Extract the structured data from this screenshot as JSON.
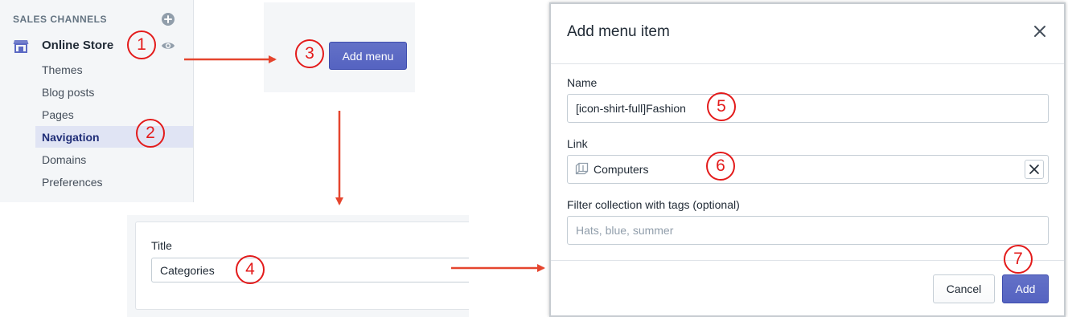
{
  "sidebar": {
    "section_title": "SALES CHANNELS",
    "add_icon": "plus-circle-icon",
    "store": {
      "label": "Online Store",
      "icon": "store-icon",
      "view_icon": "eye-icon"
    },
    "items": [
      {
        "label": "Themes",
        "active": false
      },
      {
        "label": "Blog posts",
        "active": false
      },
      {
        "label": "Pages",
        "active": false
      },
      {
        "label": "Navigation",
        "active": true
      },
      {
        "label": "Domains",
        "active": false
      },
      {
        "label": "Preferences",
        "active": false
      }
    ]
  },
  "add_menu": {
    "button_label": "Add menu"
  },
  "menu_form": {
    "title_label": "Title",
    "title_value": "Categories"
  },
  "modal": {
    "title": "Add menu item",
    "close_icon": "close-icon",
    "name": {
      "label": "Name",
      "value": "[icon-shirt-full]Fashion"
    },
    "link": {
      "label": "Link",
      "value": "Computers",
      "icon": "collection-icon",
      "clear_icon": "close-icon"
    },
    "filter": {
      "label": "Filter collection with tags (optional)",
      "placeholder": "Hats, blue, summer"
    },
    "cancel_label": "Cancel",
    "add_label": "Add"
  },
  "steps": [
    "1",
    "2",
    "3",
    "4",
    "5",
    "6",
    "7"
  ],
  "colors": {
    "accent": "#5c6ac4",
    "annotation": "#e31b1b",
    "sidebar_bg": "#f4f6f8",
    "active_bg": "#e0e4f4"
  }
}
